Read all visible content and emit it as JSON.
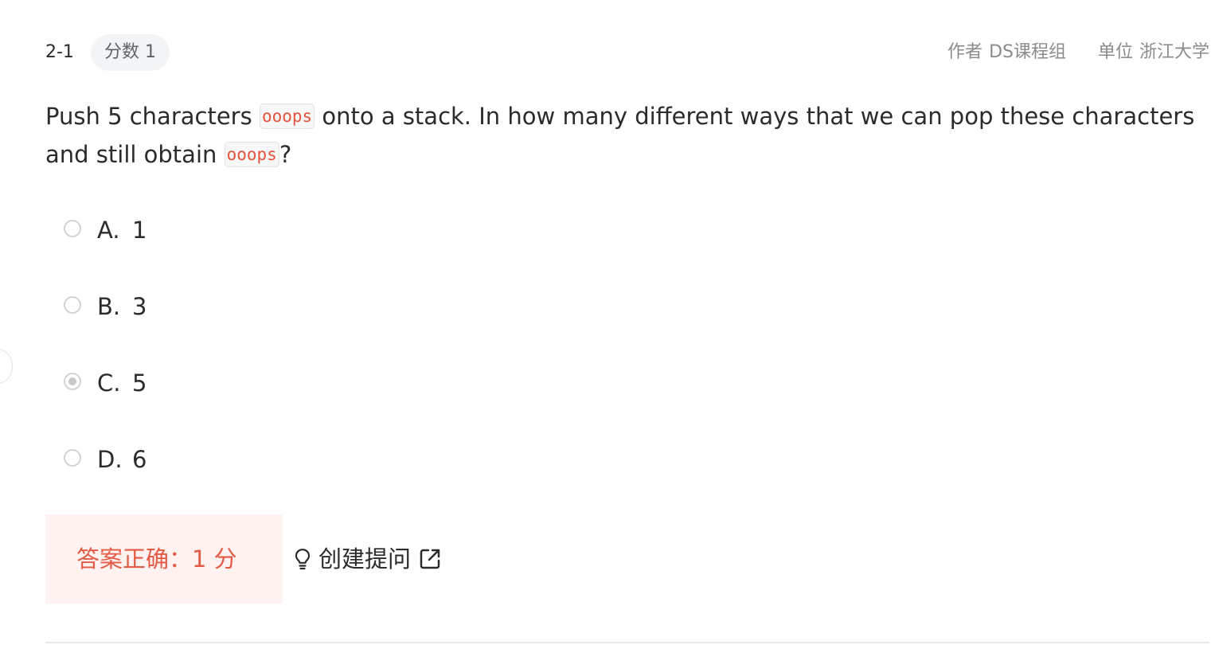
{
  "problem": {
    "number": "2-1",
    "score_label": "分数",
    "score_value": "1",
    "author_label": "作者",
    "author_value": "DS课程组",
    "unit_label": "单位",
    "unit_value": "浙江大学"
  },
  "question": {
    "text_before_code": "Push 5 characters ",
    "code_1": "ooops",
    "text_middle": " onto a stack. In how many different ways that we can pop these characters and still obtain ",
    "code_2": "ooops",
    "text_after": "?"
  },
  "options": [
    {
      "letter": "A.",
      "value": "1",
      "checked": false
    },
    {
      "letter": "B.",
      "value": "3",
      "checked": false
    },
    {
      "letter": "C.",
      "value": "5",
      "checked": true
    },
    {
      "letter": "D.",
      "value": "6",
      "checked": false
    }
  ],
  "result": {
    "text": "答案正确：1 分"
  },
  "actions": {
    "create_question_label": "创建提问"
  },
  "icons": {
    "lightbulb": "lightbulb-icon",
    "external_link": "external-link-icon"
  },
  "colors": {
    "code_text": "#e4533c",
    "result_text": "#e45b45",
    "result_background": "#fff2f0",
    "score_pill_background": "#f3f4f6",
    "muted_text": "#8b8b8b"
  }
}
